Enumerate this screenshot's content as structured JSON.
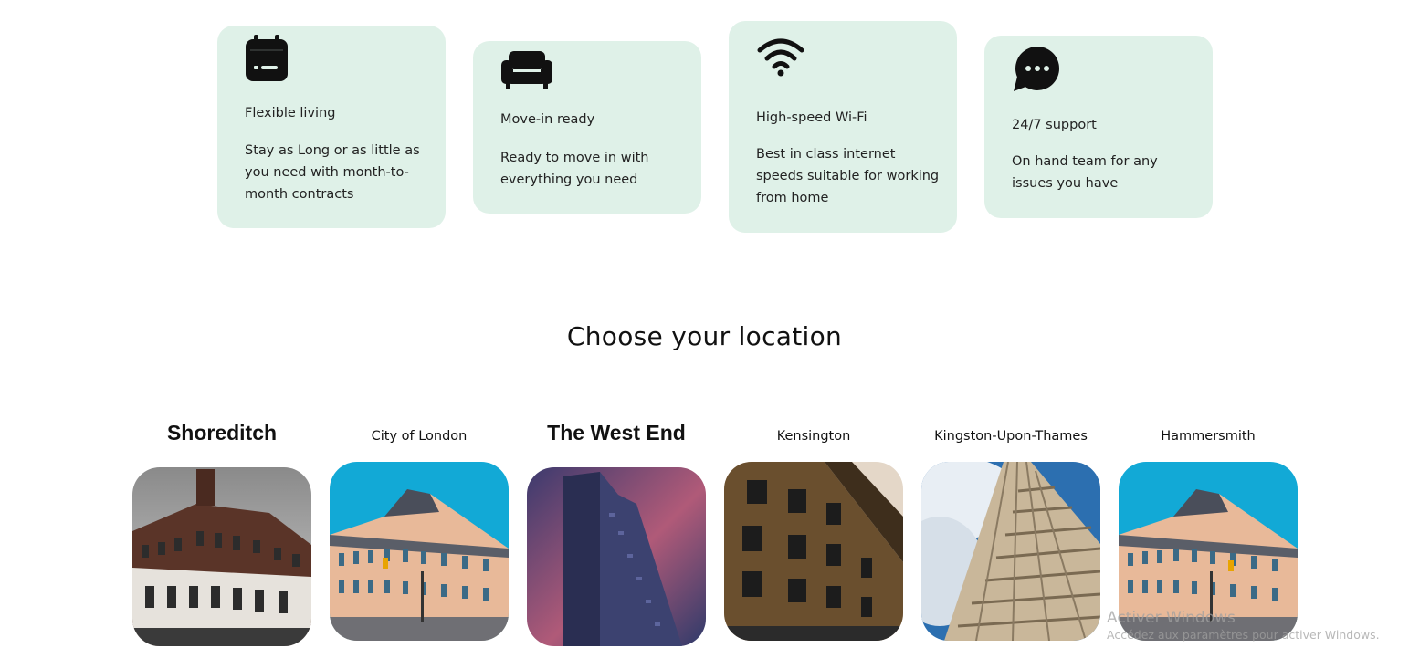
{
  "features": [
    {
      "icon": "calendar-icon",
      "title": "Flexible living",
      "desc": "Stay as Long or as little as you need with month-to-month contracts"
    },
    {
      "icon": "sofa-icon",
      "title": "Move-in ready",
      "desc": "Ready to move in with everything you need"
    },
    {
      "icon": "wifi-icon",
      "title": "High-speed Wi-Fi",
      "desc": "Best in class internet speeds suitable for working from home"
    },
    {
      "icon": "chat-bubble-icon",
      "title": "24/7 support",
      "desc": "On hand team for any issues you have"
    }
  ],
  "section": {
    "heading": "Choose your location"
  },
  "locations": [
    {
      "name": "Shoreditch"
    },
    {
      "name": "City of London"
    },
    {
      "name": "The West End"
    },
    {
      "name": "Kensington"
    },
    {
      "name": "Kingston-Upon-Thames"
    },
    {
      "name": "Hammersmith"
    }
  ],
  "watermark": {
    "line1": "Activer Windows",
    "line2": "Accédez aux paramètres pour activer Windows."
  },
  "colors": {
    "card_bg": "#dff1e8",
    "text": "#1f1f1f",
    "sky_blue": "#12a9d6"
  }
}
